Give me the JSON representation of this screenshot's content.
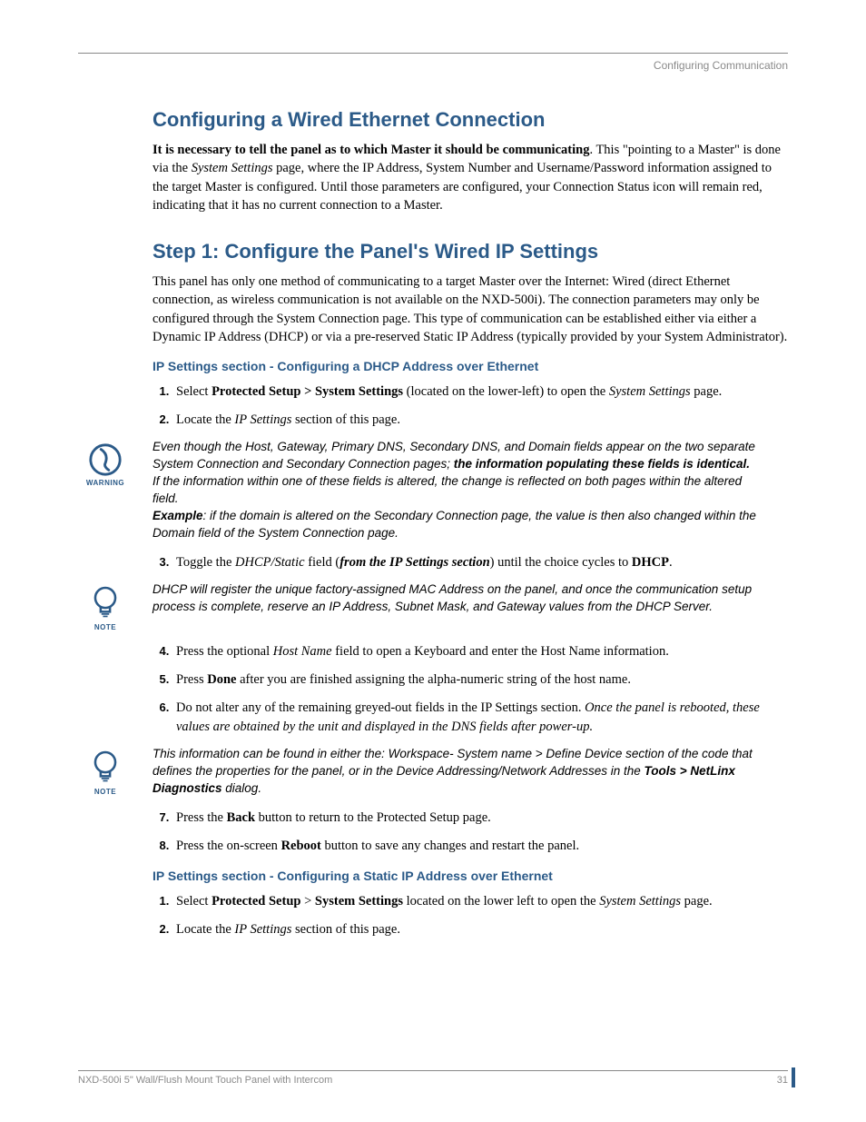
{
  "header": {
    "running_title": "Configuring Communication"
  },
  "h1": "Configuring a Wired Ethernet Connection",
  "intro": {
    "bold_lead": "It is necessary to tell the panel as to which Master it should be communicating",
    "text_1": ". This \"pointing to a Master\" is done via the ",
    "ital_1": "System Settings",
    "text_2": " page, where the IP Address, System Number and Username/Password information assigned to the target Master is configured. Until those parameters are configured, your Connection Status icon will remain red, indicating that it has no current connection to a Master."
  },
  "step1_title": "Step 1: Configure the Panel's Wired IP Settings",
  "step1_para": {
    "t1": "This panel has only one method of communicating to a target Master over the Internet: ",
    "i1": "Wired",
    "t2": " (direct Ethernet connection, as wireless communication is not available on the NXD-500i). The connection parameters may only be configured through the System Connection page. This type of communication can be established either via either a Dynamic IP Address (",
    "i2": "DHCP",
    "t3": ") or via a pre-reserved Static IP Address (",
    "i3": "typically provided by your System Administrator",
    "t4": ")."
  },
  "sub_a": "IP Settings section - Configuring a DHCP Address over Ethernet",
  "list_a_1": {
    "t1": "Select ",
    "b1": "Protected Setup > System Settings",
    "t2": " (located on the lower-left) to open the ",
    "i1": "System Settings",
    "t3": " page."
  },
  "list_a_2": {
    "t1": "Locate the ",
    "i1": "IP Settings",
    "t2": " section of this page."
  },
  "warn": {
    "label": "WARNING",
    "l1": "Even though the Host, Gateway, Primary DNS, Secondary DNS, and Domain fields appear on the two separate System Connection and Secondary Connection pages; ",
    "b1": "the information populating these fields is identical.",
    "l2": "If the information within one of these fields is altered, the change is reflected on both pages within the altered field.",
    "b2": "Example",
    "l3": ": if the domain is altered on the Secondary Connection page, the value is then also changed within the Domain field of the System Connection page."
  },
  "list_a_3": {
    "t1": "Toggle the ",
    "i1": "DHCP/Static",
    "t2": " field (",
    "bi1": "from the IP Settings section",
    "t3": ") until the choice cycles to ",
    "b1": "DHCP",
    "t4": "."
  },
  "note1": {
    "label": "NOTE",
    "text": "DHCP will register the unique factory-assigned MAC Address on the panel, and once the communication setup process is complete, reserve an IP Address, Subnet Mask, and Gateway values from the DHCP Server."
  },
  "list_a_4": {
    "t1": "Press the optional ",
    "i1": "Host Name",
    "t2": " field to open a Keyboard and enter the Host Name information."
  },
  "list_a_5": {
    "t1": "Press ",
    "b1": "Done",
    "t2": " after you are finished assigning the alpha-numeric string of the host name."
  },
  "list_a_6": {
    "t1": "Do not alter any of the remaining greyed-out fields in the IP Settings section. ",
    "i1": "Once the panel is rebooted, these values are obtained by the unit and displayed in the DNS fields after power-up."
  },
  "note2": {
    "label": "NOTE",
    "t1": "This information can be found in either the: Workspace- System name > Define Device section of the code that defines the properties for the panel, or in the Device Addressing/Network Addresses in the ",
    "b1": "Tools > NetLinx Diagnostics",
    "t2": " dialog."
  },
  "list_a_7": {
    "t1": "Press the ",
    "b1": "Back",
    "t2": " button to return to the Protected Setup page."
  },
  "list_a_8": {
    "t1": "Press the on-screen ",
    "b1": "Reboot",
    "t2": " button to save any changes and restart the panel."
  },
  "sub_b": "IP Settings section - Configuring a Static IP Address over Ethernet",
  "list_b_1": {
    "t1": "Select ",
    "b1": "Protected Setup",
    "t2": " > ",
    "b2": "System Settings",
    "t3": " located on the lower left to open the ",
    "i1": "System Settings",
    "t4": " page."
  },
  "list_b_2": {
    "t1": "Locate the ",
    "i1": "IP Settings",
    "t2": " section of this page."
  },
  "footer": {
    "product": "NXD-500i 5\" Wall/Flush Mount Touch Panel with Intercom",
    "page": "31"
  }
}
